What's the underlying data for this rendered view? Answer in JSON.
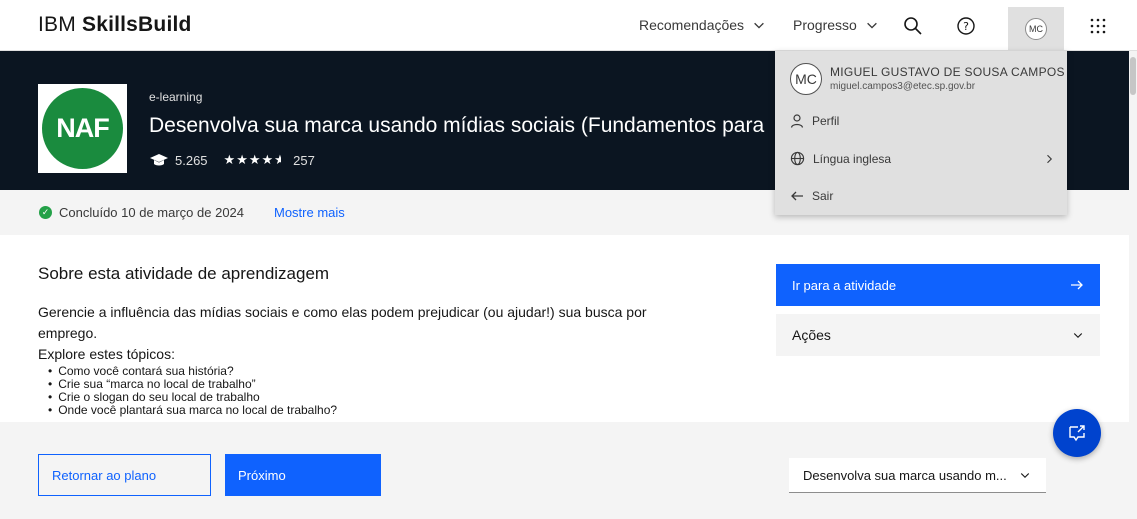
{
  "header": {
    "brand_prefix": "IBM",
    "brand_name": "SkillsBuild",
    "nav_recommendations": "Recomendações",
    "nav_progress": "Progresso",
    "avatar_initials": "MC"
  },
  "banner": {
    "logo_text": "NAF",
    "kind": "e-learning",
    "title": "Desenvolva sua marca usando mídias sociais (Fundamentos para",
    "learners": "5.265",
    "rating_stars": "★★★★",
    "rating_count": "257"
  },
  "status": {
    "completed_text": "Concluído 10 de março de 2024",
    "show_more": "Mostre mais"
  },
  "main": {
    "section_title": "Sobre esta atividade de aprendizagem",
    "description": "Gerencie a influência das mídias sociais e como elas podem prejudicar (ou ajudar!) sua busca por emprego.",
    "explore_heading": "Explore estes tópicos:",
    "topics": [
      "Como você contará sua história?",
      "Crie sua “marca no local de trabalho”",
      "Crie o slogan do seu local de trabalho",
      "Onde você plantará sua marca no local de trabalho?"
    ]
  },
  "sidebar": {
    "go_button": "Ir para a atividade",
    "actions_label": "Ações"
  },
  "footer": {
    "back_button": "Retornar ao plano",
    "next_button": "Próximo",
    "select_value": "Desenvolva sua marca usando m..."
  },
  "user_menu": {
    "initials": "MC",
    "name": "MIGUEL GUSTAVO DE SOUSA CAMPOS",
    "email": "miguel.campos3@etec.sp.gov.br",
    "profile": "Perfil",
    "language": "Língua inglesa",
    "logout": "Sair"
  },
  "colors": {
    "primary": "#0f62fe",
    "banner_bg": "#0b1521",
    "success": "#24a148",
    "logo_green": "#1a8b3e"
  }
}
